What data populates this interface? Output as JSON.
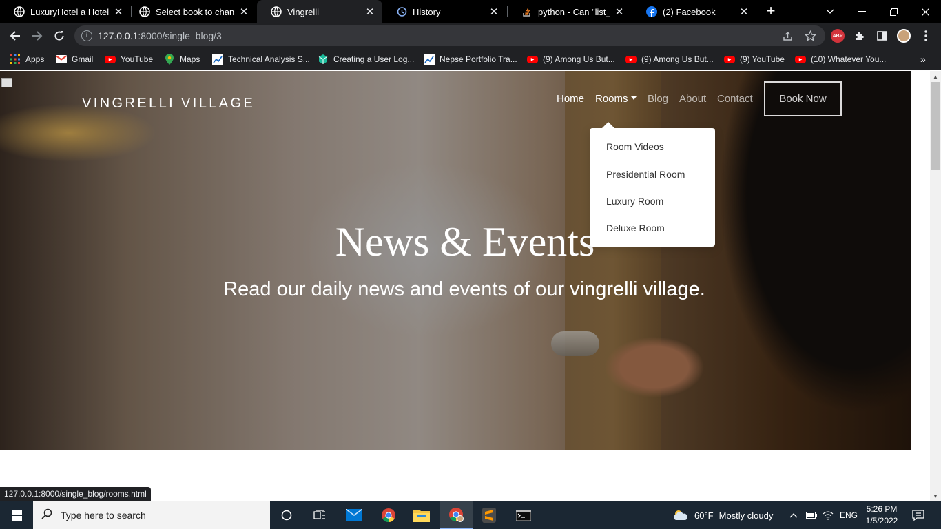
{
  "browser": {
    "tabs": [
      {
        "title": "LuxuryHotel a Hotel Te",
        "icon": "globe-icon",
        "active": false
      },
      {
        "title": "Select book to change",
        "icon": "globe-icon",
        "active": false
      },
      {
        "title": "Vingrelli",
        "icon": "globe-icon",
        "active": true
      },
      {
        "title": "History",
        "icon": "history-icon",
        "active": false
      },
      {
        "title": "python - Can \"list_disp",
        "icon": "stackoverflow-icon",
        "active": false
      },
      {
        "title": "(2) Facebook",
        "icon": "facebook-icon",
        "active": false
      }
    ],
    "url_host": "127.0.0.1",
    "url_path": ":8000/single_blog/3",
    "bookmarks": [
      {
        "label": "Apps",
        "icon": "apps-grid-icon"
      },
      {
        "label": "Gmail",
        "icon": "gmail-icon"
      },
      {
        "label": "YouTube",
        "icon": "youtube-icon"
      },
      {
        "label": "Maps",
        "icon": "maps-pin-icon"
      },
      {
        "label": "Technical Analysis S...",
        "icon": "chart-icon"
      },
      {
        "label": "Creating a User Log...",
        "icon": "cube-icon"
      },
      {
        "label": "Nepse Portfolio Tra...",
        "icon": "chart-icon"
      },
      {
        "label": "(9) Among Us But...",
        "icon": "youtube-icon"
      },
      {
        "label": "(9) Among Us But...",
        "icon": "youtube-icon"
      },
      {
        "label": "(9) YouTube",
        "icon": "youtube-icon"
      },
      {
        "label": "(10) Whatever You...",
        "icon": "youtube-icon"
      }
    ],
    "abp_label": "ABP",
    "status_url": "127.0.0.1:8000/single_blog/rooms.html"
  },
  "site": {
    "brand": "VINGRELLI VILLAGE",
    "nav": {
      "home": "Home",
      "rooms": "Rooms",
      "blog": "Blog",
      "about": "About",
      "contact": "Contact"
    },
    "book_now": "Book Now",
    "rooms_menu": [
      "Room Videos",
      "Presidential Room",
      "Luxury Room",
      "Deluxe Room"
    ],
    "hero_title": "News & Events",
    "hero_subtitle": "Read our daily news and events of our vingrelli village."
  },
  "taskbar": {
    "search_placeholder": "Type here to search",
    "weather_temp": "60°F",
    "weather_desc": "Mostly cloudy",
    "language": "ENG",
    "time": "5:26 PM",
    "date": "1/5/2022"
  }
}
